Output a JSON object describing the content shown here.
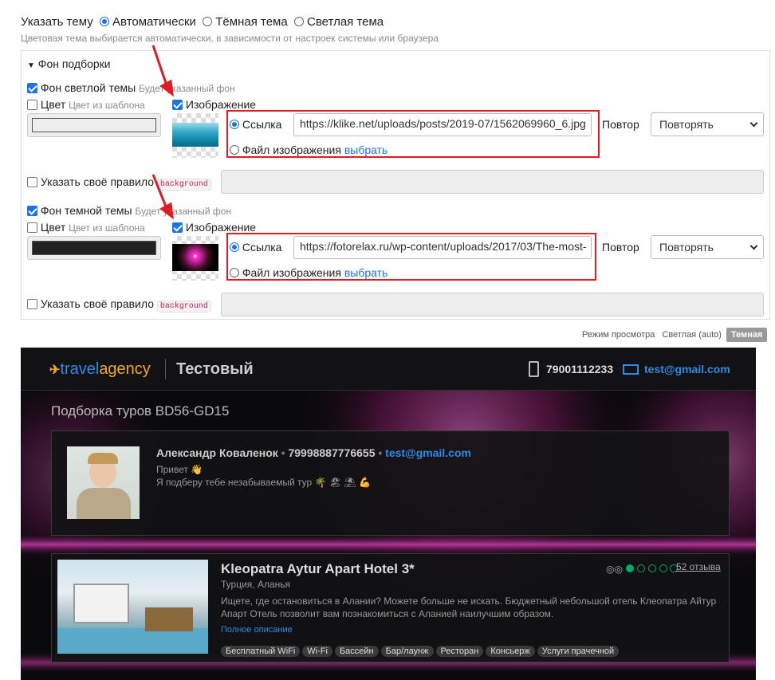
{
  "theme": {
    "label": "Указать тему",
    "options": [
      "Автоматически",
      "Тёмная тема",
      "Светлая тема"
    ],
    "hint": "Цветовая тема выбирается автоматически, в зависимости от настроек системы или браузера"
  },
  "bg_section": {
    "title": "Фон подборки",
    "light": {
      "enable_label": "Фон светлой темы",
      "enable_hint": "Будет указанный фон",
      "color_label": "Цвет",
      "color_hint": "Цвет из шаблона",
      "image_label": "Изображение",
      "link_label": "Ссылка",
      "url": "https://klike.net/uploads/posts/2019-07/1562069960_6.jpg",
      "file_label": "Файл изображения",
      "choose_label": "выбрать",
      "repeat_label": "Повтор",
      "repeat_value": "Повторять",
      "rule_label": "Указать своё правило",
      "rule_code": "background"
    },
    "dark": {
      "enable_label": "Фон темной темы",
      "enable_hint": "Будет указанный фон",
      "color_label": "Цвет",
      "color_hint": "Цвет из шаблона",
      "image_label": "Изображение",
      "link_label": "Ссылка",
      "url": "https://fotorelax.ru/wp-content/uploads/2017/03/The-most-",
      "file_label": "Файл изображения",
      "choose_label": "выбрать",
      "repeat_label": "Повтор",
      "repeat_value": "Повторять",
      "rule_label": "Указать своё правило",
      "rule_code": "background"
    }
  },
  "view_mode": {
    "label": "Режим просмотра",
    "light": "Светлая (auto)",
    "dark": "Темная"
  },
  "preview": {
    "logo_travel": "travel",
    "logo_agency": "agency",
    "brand": "Тестовый",
    "phone": "79001112233",
    "email": "test@gmail.com",
    "selection_title": "Подборка туров BD56-GD15",
    "agent": {
      "name": "Александр Коваленок",
      "phone": "79998887776655",
      "email": "test@gmail.com",
      "greeting": "Привет 👋",
      "message": "Я подберу тебе незабываемый тур 🌴 🏖 ⛱ 💪"
    },
    "hotel": {
      "name": "Kleopatra Aytur Apart Hotel 3*",
      "location": "Турция, Аланья",
      "reviews": "52 отзыва",
      "rating": 1,
      "description": "Ищете, где остановиться в Алании? Можете больше не искать. Бюджетный небольшой отель Клеопатра Айтур Апарт Отель позволит вам познакомиться с Аланией наилучшим образом.",
      "more_label": "Полное описание",
      "tags": [
        "Бесплатный WiFi",
        "Wi-Fi",
        "Бассейн",
        "Бар/лаунж",
        "Ресторан",
        "Консьерж",
        "Услуги прачечной"
      ]
    }
  },
  "colors": {
    "accent": "#1a73e8",
    "annotation_red": "#e01b22",
    "tripadvisor_green": "#00aa6c"
  }
}
